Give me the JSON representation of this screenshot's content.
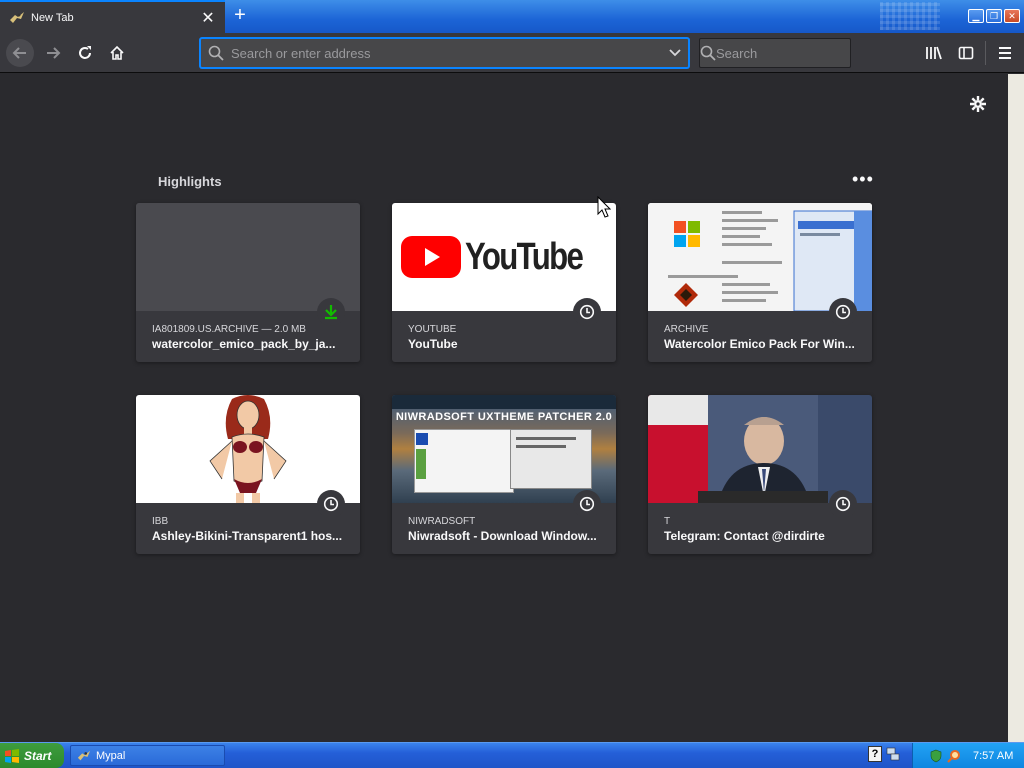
{
  "browser": {
    "tab": {
      "title": "New Tab",
      "close_glyph": "✕"
    },
    "new_tab_glyph": "+",
    "urlbar": {
      "placeholder": "Search or enter address"
    },
    "searchbar": {
      "placeholder": "Search"
    }
  },
  "highlights": {
    "title": "Highlights",
    "more_glyph": "•••",
    "cards": [
      {
        "host": "IA801809.US.ARCHIVE — 2.0 MB",
        "title": "watercolor_emico_pack_by_ja...",
        "badge": "download-icon"
      },
      {
        "host": "YOUTUBE",
        "title": "YouTube",
        "badge": "clock-icon",
        "logo_text": "YouTube"
      },
      {
        "host": "ARCHIVE",
        "title": "Watercolor Emico Pack For Win...",
        "badge": "clock-icon"
      },
      {
        "host": "IBB",
        "title": "Ashley-Bikini-Transparent1 hos...",
        "badge": "clock-icon"
      },
      {
        "host": "NIWRADSOFT",
        "title": "Niwradsoft - Download Window...",
        "badge": "clock-icon",
        "thumb_text": "NIWRADSOFT UXTHEME PATCHER 2.0"
      },
      {
        "host": "T",
        "title": "Telegram: Contact @dirdirte",
        "badge": "clock-icon"
      }
    ]
  },
  "taskbar": {
    "start_label": "Start",
    "task_label": "Mypal",
    "clock": "7:57 AM"
  },
  "colors": {
    "accent": "#0a84ff",
    "toolbar": "#38383d",
    "content_bg": "#2a2a2e",
    "download_green": "#12bc00"
  }
}
